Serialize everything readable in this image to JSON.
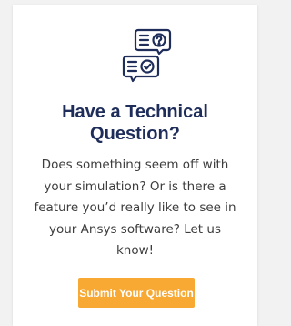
{
  "card": {
    "icon": "chat-question-check-icon",
    "title_lines": [
      "Have a Technical",
      "Question?"
    ],
    "description_lines": [
      "Does something seem off with",
      "your simulation? Or is there a",
      "feature you’d really like to see in",
      "your Ansys software? Let us",
      "know!"
    ],
    "button_label": "Submit Your Question"
  },
  "colors": {
    "title": "#1f2d5a",
    "text": "#3d3d3d",
    "accent": "#f8a934",
    "icon_stroke": "#1f2d5a"
  }
}
